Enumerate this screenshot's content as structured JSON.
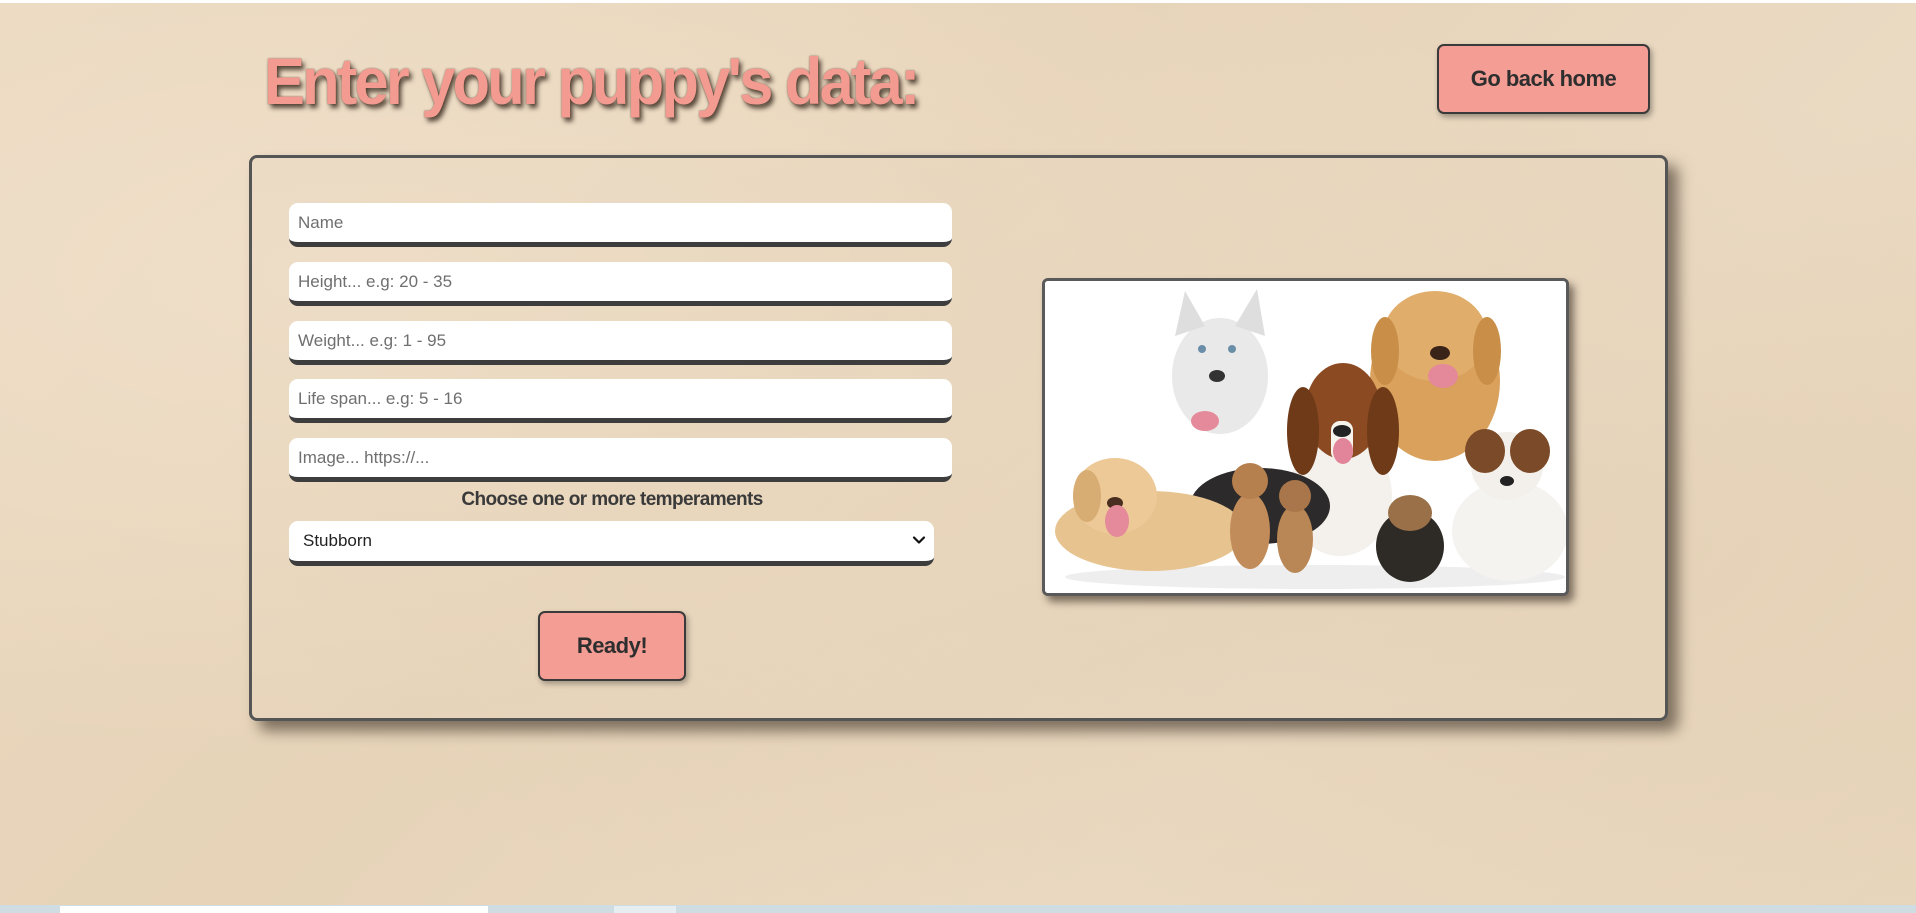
{
  "page": {
    "title": "Enter your puppy's data:",
    "home_button": "Go back home"
  },
  "form": {
    "name_placeholder": "Name",
    "height_placeholder": "Height... e.g: 20 - 35",
    "weight_placeholder": "Weight... e.g: 1 - 95",
    "lifespan_placeholder": "Life span... e.g: 5 - 16",
    "image_placeholder": "Image... https://...",
    "temperaments_label": "Choose one or more temperaments",
    "temperament_selected": "Stubborn",
    "submit_label": "Ready!"
  },
  "colors": {
    "accent": "#f39d94",
    "title": "#f39b90",
    "background": "#e8d6bc",
    "border": "#3d3d3d"
  },
  "icons": {
    "select_arrow": "chevron-down-icon"
  }
}
